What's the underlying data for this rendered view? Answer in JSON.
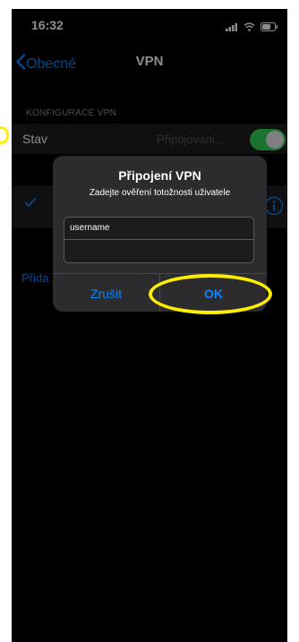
{
  "status_bar": {
    "time": "16:32",
    "icons": [
      "cellular-icon",
      "wifi-icon",
      "battery-icon"
    ]
  },
  "nav": {
    "back_label": "Obecné",
    "title": "VPN"
  },
  "section": {
    "header": "KONFIGURACE VPN"
  },
  "status_row": {
    "label": "Stav",
    "value": "Připojování...",
    "toggle_on": true
  },
  "config_row": {
    "selected": true
  },
  "add_config": {
    "label": "Přida"
  },
  "alert": {
    "title": "Připojení VPN",
    "message": "Zadejte ověření totožnosti uživatele",
    "fields": [
      {
        "value": "username",
        "placeholder": ""
      },
      {
        "value": "",
        "placeholder": ""
      }
    ],
    "cancel_label": "Zrušit",
    "ok_label": "OK"
  },
  "colors": {
    "accent": "#0a84ff",
    "toggle_on": "#30d158",
    "annotation": "#ffee00"
  }
}
